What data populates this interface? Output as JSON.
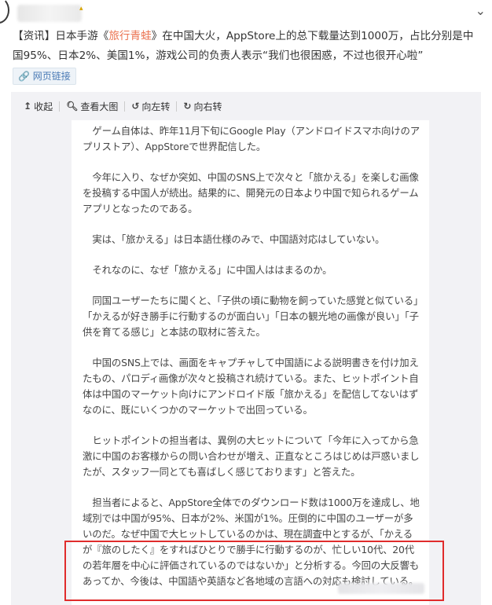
{
  "post": {
    "text_prefix": "【资讯】日本手游《",
    "game_name": "旅行青蛙",
    "text_suffix": "》在中国大火，AppStore上的总下载量达到1000万，占比分别是中国95%、日本2%、美国1%，游戏公司的负责人表示“我们也很困惑，不过也很开心啦”",
    "link_label": "网页链接",
    "link_icon": "link-icon"
  },
  "toolbar": {
    "collapse": "收起",
    "view_large": "查看大图",
    "rotate_left": "向左转",
    "rotate_right": "向右转"
  },
  "colors": {
    "highlight": "#eb7350",
    "annotation_box": "#e02c2c",
    "link": "#4a7ab5"
  },
  "article": {
    "paragraphs": [
      "ゲーム自体は、昨年11月下旬にGoogle Play（アンドロイドスマホ向けのアプリストア）、AppStoreで世界配信した。",
      "今年に入り、なぜか突如、中国のSNS上で次々と「旅かえる」を楽しむ画像を投稿する中国人が続出。結果的に、開発元の日本より中国で知られるゲームアプリとなったのである。",
      "実は、「旅かえる」は日本語仕様のみで、中国語対応はしていない。",
      "それなのに、なぜ「旅かえる」に中国人ははまるのか。",
      "同国ユーザーたちに聞くと、「子供の頃に動物を飼っていた感覚と似ている」「かえるが好き勝手に行動するのが面白い」「日本の観光地の画像が良い」「子供を育てる感じ」と本誌の取材に答えた。",
      "中国のSNS上では、画面をキャプチャして中国語による説明書きを付け加えたもの、パロディ画像が次々と投稿され続けている。また、ヒットポイント自体は中国のマーケット向けにアンドロイド版「旅かえる」を配信してないはずなのに、既にいくつかのマーケットで出回っている。",
      "ヒットポイントの担当者は、異例の大ヒットについて「今年に入ってから急激に中国のお客様からの問い合わせが増え、正直なところはじめは戸惑いましたが、スタッフ一同とても喜ばしく感じております」と答えた。",
      "担当者によると、AppStore全体でのダウンロード数は1000万を達成し、地域別では中国が95%、日本が2%、米国が1%。圧倒的に中国のユーザーが多いのだ。なぜ中国で大ヒットしているのかは、現在調査中とするが、「かえるが『旅のしたく』をすればひとりで勝手に行動するのが、忙しい10代、20代の若年層を中心に評価されているのではないか」と分析する。今回の大反響もあってか、今後は、中国語や英語など各地域の言語への対応も検討している。"
    ]
  }
}
